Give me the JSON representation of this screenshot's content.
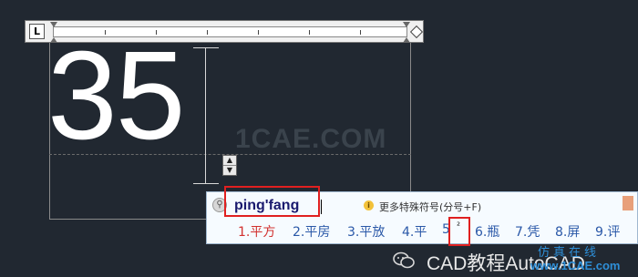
{
  "ruler": {
    "tab_glyph": "L",
    "ticks": 6
  },
  "editor": {
    "text": "35",
    "watermark": "1CAE.COM",
    "stepper_up": "▲",
    "stepper_down": "▼"
  },
  "ime": {
    "input": "ping'fang",
    "more_symbols": "更多特殊符号(分号+F)",
    "info_icon": "i",
    "candidates": [
      "1.平方",
      "2.平房",
      "3.平放",
      "4.平",
      "5",
      "²",
      "6.瓶",
      "7.凭",
      "8.屏",
      "9.评"
    ]
  },
  "footer": {
    "brand": "CAD教程AutoCAD",
    "site": "www.1CAE.com",
    "site_cn": "仿真在线"
  },
  "colors": {
    "background": "#212831",
    "highlight": "#e02020",
    "candidate_first": "#d2312f",
    "candidate": "#2a58a8"
  }
}
